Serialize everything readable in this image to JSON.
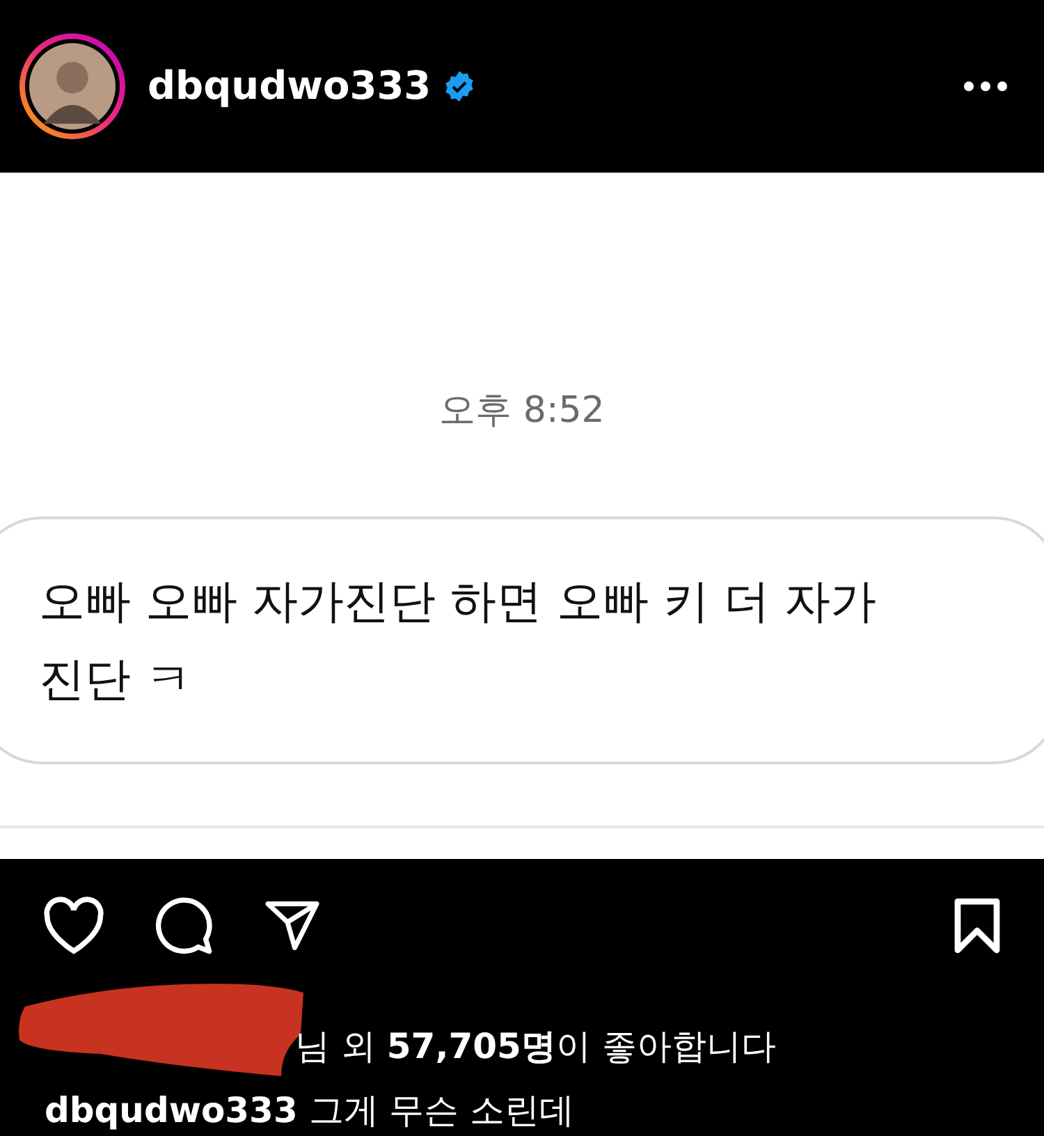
{
  "header": {
    "username": "dbqudwo333",
    "verified": true
  },
  "post": {
    "time": "오후 8:52",
    "message": "오빠 오빠 자가진단 하면 오빠 키 더 자가\n진단 ㅋ"
  },
  "actions": {
    "liked": false,
    "saved": false
  },
  "likes": "님 외 **57,705명**이 좋아합니다",
  "caption": {
    "username": "dbqudwo333",
    "text": "그게 무슨 소린데"
  }
}
